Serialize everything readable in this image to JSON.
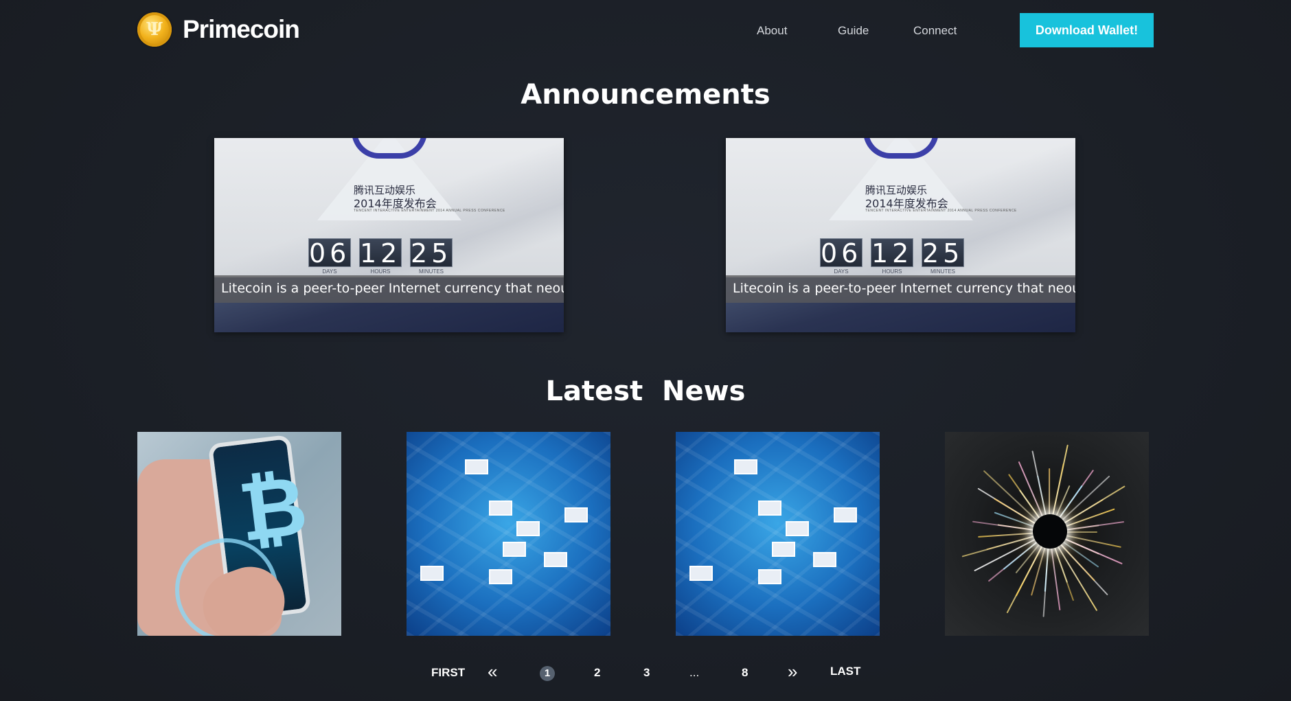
{
  "header": {
    "logo_text": "Primecoin",
    "logo_symbol": "Ψ",
    "nav": [
      "About",
      "Guide",
      "Connect"
    ],
    "cta_label": "Download Wallet!"
  },
  "colors": {
    "background": "#1b1f26",
    "accent": "#18c2dc",
    "coin_gold": "#f2b21c"
  },
  "announcements": {
    "title": "Announcements",
    "items": [
      {
        "caption": "Litecoin is a peer-to-peer Internet currency that neout .",
        "poster_line1": "腾讯互动娱乐",
        "poster_line2": "2014年度发布会",
        "poster_line3": "TENCENT INTERACTIVE ENTERTAINMENT 2014 ANNUAL PRESS CONFERENCE",
        "countdown": {
          "days": "06",
          "hours": "12",
          "minutes": "25",
          "days_label": "DAYS",
          "hours_label": "HOURS",
          "minutes_label": "MINUTES"
        }
      },
      {
        "caption": "Litecoin is a peer-to-peer Internet currency that neout .",
        "poster_line1": "腾讯互动娱乐",
        "poster_line2": "2014年度发布会",
        "poster_line3": "TENCENT INTERACTIVE ENTERTAINMENT 2014 ANNUAL PRESS CONFERENCE",
        "countdown": {
          "days": "06",
          "hours": "12",
          "minutes": "25",
          "days_label": "DAYS",
          "hours_label": "HOURS",
          "minutes_label": "MINUTES"
        }
      }
    ]
  },
  "news": {
    "title": "Latest  News",
    "items": [
      {
        "image": "bitcoin-phone-in-hand"
      },
      {
        "image": "blue-city-video-wall"
      },
      {
        "image": "blue-city-video-wall"
      },
      {
        "image": "glowing-particle-burst"
      }
    ]
  },
  "pagination": {
    "first": "FIRST",
    "prev_icon": "double-chevron-left-icon",
    "pages": [
      "1",
      "2",
      "3",
      "...",
      "8"
    ],
    "current": "1",
    "next_icon": "double-chevron-right-icon",
    "last": "LAST"
  }
}
